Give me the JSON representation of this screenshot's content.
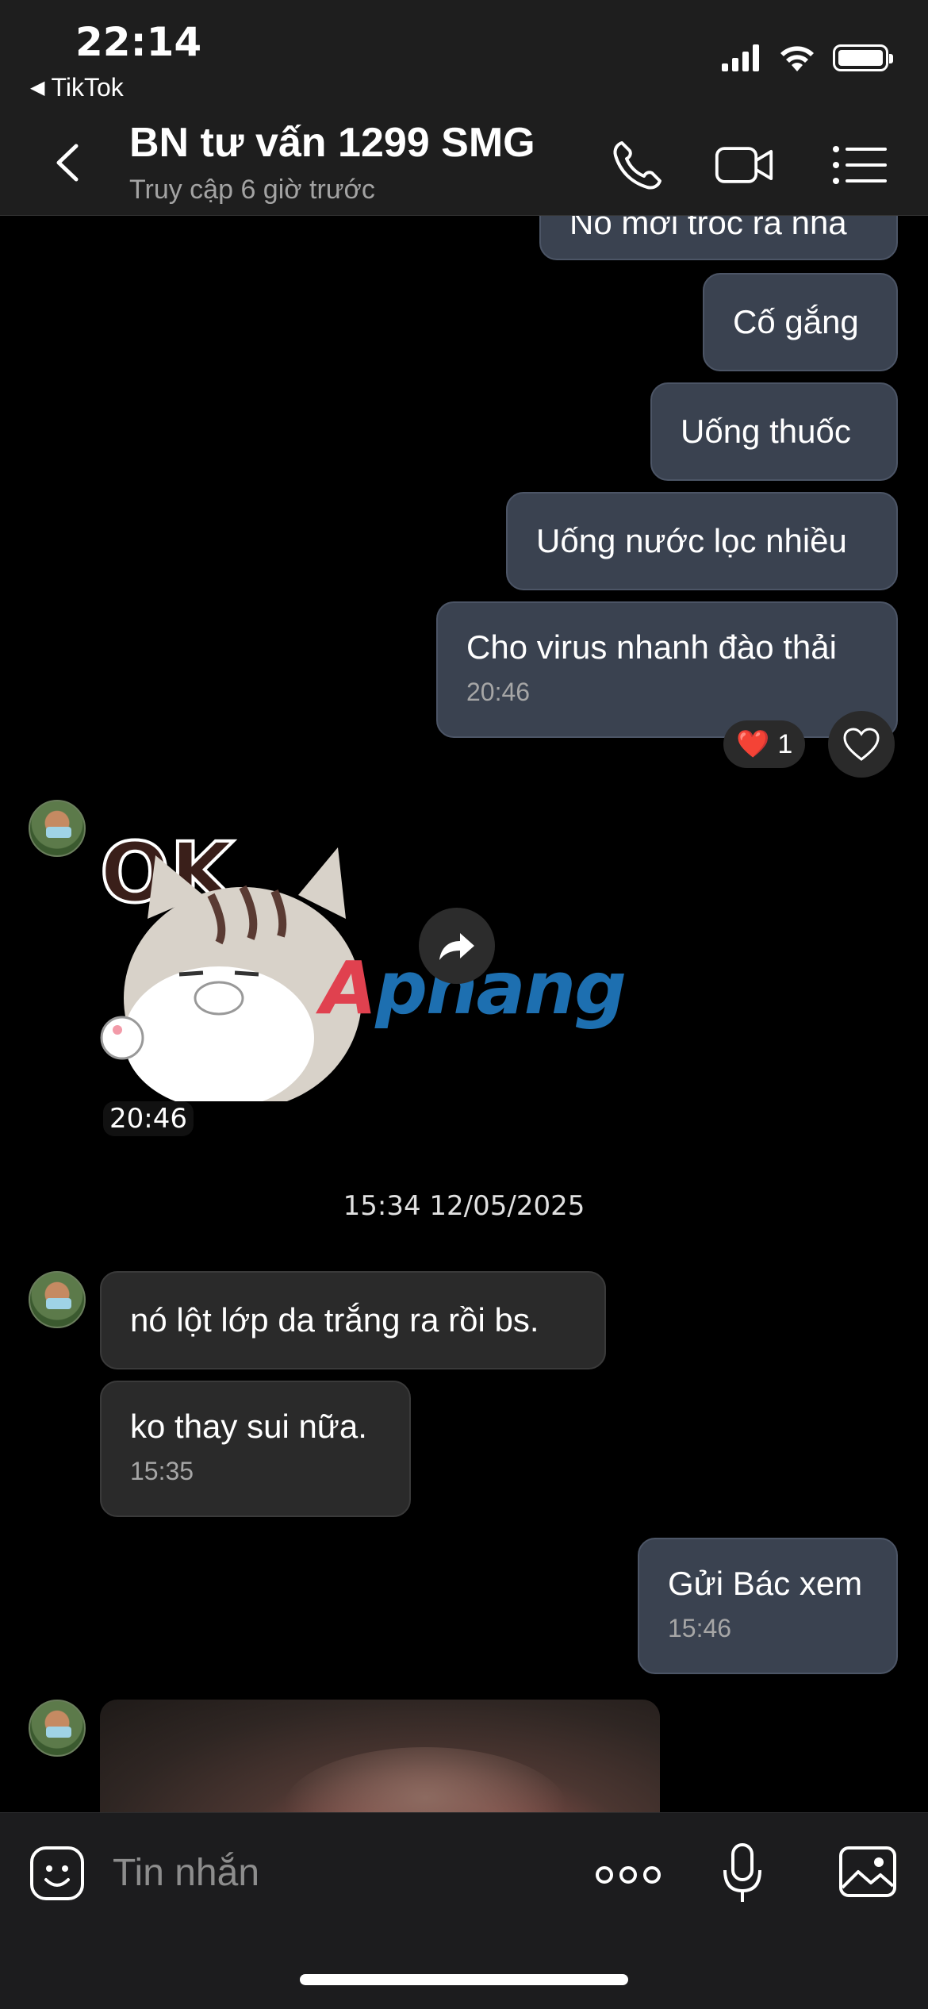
{
  "status_bar": {
    "time": "22:14",
    "back_app": "TikTok",
    "back_glyph": "◀"
  },
  "header": {
    "title": "BN tư vấn 1299 SMG",
    "subtitle": "Truy cập 6 giờ trước"
  },
  "messages": {
    "m0": {
      "text": "Nó mới tróc ra nha"
    },
    "m1": {
      "text": "Cố gắng"
    },
    "m2": {
      "text": "Uống thuốc"
    },
    "m3": {
      "text": "Uống nước lọc nhiều"
    },
    "m4": {
      "text": "Cho virus nhanh đào thải",
      "time": "20:46"
    },
    "reaction": {
      "emoji": "❤️",
      "count": "1"
    },
    "sticker": {
      "caption": "OK",
      "time": "20:46",
      "watermark_a": "A",
      "watermark_rest": "phang"
    },
    "date_separator": "15:34 12/05/2025",
    "m5": {
      "text": "nó lột lớp da trắng ra rồi bs."
    },
    "m6": {
      "text": "ko thay sui nữa.",
      "time": "15:35"
    },
    "m7": {
      "text": "Gửi Bác xem",
      "time": "15:46"
    }
  },
  "composer": {
    "placeholder": "Tin nhắn"
  },
  "colors": {
    "outgoing_bubble": "#3a4250",
    "incoming_bubble": "#2a2a2a",
    "background": "#000000"
  }
}
